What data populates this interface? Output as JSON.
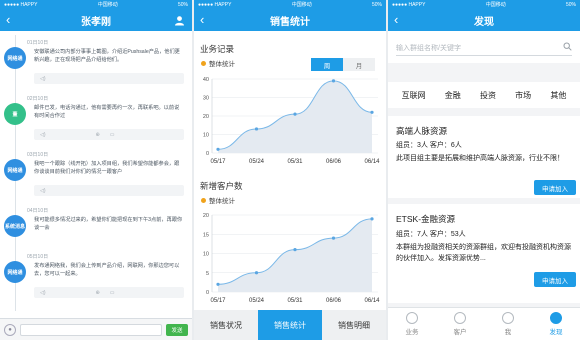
{
  "status": {
    "carrier": "●●●●● HAPPY",
    "time_left": "中国移动",
    "battery": "50%"
  },
  "screen1": {
    "title": "张孝刚",
    "messages": [
      {
        "time": "01日10日",
        "avatar": "网络通",
        "avatar_color": "#2f8fe0",
        "text": "安徽联通公司内部分事事上截图，介绍近Pushsale产品，他们更新兴趣，正在现场把产品介绍给他们。"
      },
      {
        "time": "02日10日",
        "avatar": "董",
        "avatar_color": "#33c08a",
        "text": "邮件已发，电话沟通过，他有需要再约一次，再联系吧。以前说有时间合作过"
      },
      {
        "time": "03日10日",
        "avatar": "网络通",
        "avatar_color": "#2f8fe0",
        "text": "我吧一个跟踪（线开拓）加入项目组，我们希望你能都参会，跟你谈谈目前我们对你们的情况一跟客户"
      },
      {
        "time": "04日10日",
        "avatar": "系统消息",
        "avatar_color": "#2f8fe0",
        "text": "我可能很多情况过来的，希望你们能把现在到下午3点前，再跟你谈一会"
      },
      {
        "time": "05日10日",
        "avatar": "网络通",
        "avatar_color": "#2f8fe0",
        "text": "发布通网络我，我们会上传到产品介绍，网联网，你那边您可以去，您可以一起来。"
      }
    ],
    "send_label": "发送"
  },
  "screen2": {
    "title": "销售统计",
    "sec1_title": "业务记录",
    "sec2_title": "新增客户数",
    "legend_label": "整体统计",
    "toggle": [
      "周",
      "月"
    ],
    "tabs": [
      "销售状况",
      "销售统计",
      "销售明细"
    ]
  },
  "screen3": {
    "title": "发现",
    "search_placeholder": "输入群组名称/关键字",
    "categories": [
      "互联网",
      "金融",
      "投资",
      "市场",
      "其他"
    ],
    "cards": [
      {
        "title": "高端人脉资源",
        "meta": "组员：3人 客户：6人",
        "desc": "此项目组主要是拓展和维护高端人脉资源，行业不限！",
        "join": "申请加入"
      },
      {
        "title": "ETSK-金融资源",
        "meta": "组员：7人 客户：53人",
        "desc": "本群组为投融资相关的资源群组，欢迎有投融资机构资源的伙伴加入。发挥资源优势...",
        "join": "申请加入"
      }
    ],
    "tabs": [
      "业务",
      "客户",
      "我",
      "发现"
    ]
  },
  "chart_data": [
    {
      "type": "area",
      "title": "业务记录",
      "categories": [
        "05/17",
        "05/24",
        "05/31",
        "06/06",
        "06/14"
      ],
      "series": [
        {
          "name": "整体统计",
          "values": [
            2,
            13,
            21,
            39,
            22
          ]
        }
      ],
      "ylim": [
        0,
        40
      ],
      "yticks": [
        0,
        10,
        20,
        30,
        40
      ],
      "grid": true
    },
    {
      "type": "area",
      "title": "新增客户数",
      "categories": [
        "05/17",
        "05/24",
        "05/31",
        "06/06",
        "06/14"
      ],
      "series": [
        {
          "name": "整体统计",
          "values": [
            2,
            5,
            11,
            14,
            19
          ]
        }
      ],
      "ylim": [
        0,
        20
      ],
      "yticks": [
        0,
        5,
        10,
        15,
        20
      ],
      "grid": true
    }
  ]
}
